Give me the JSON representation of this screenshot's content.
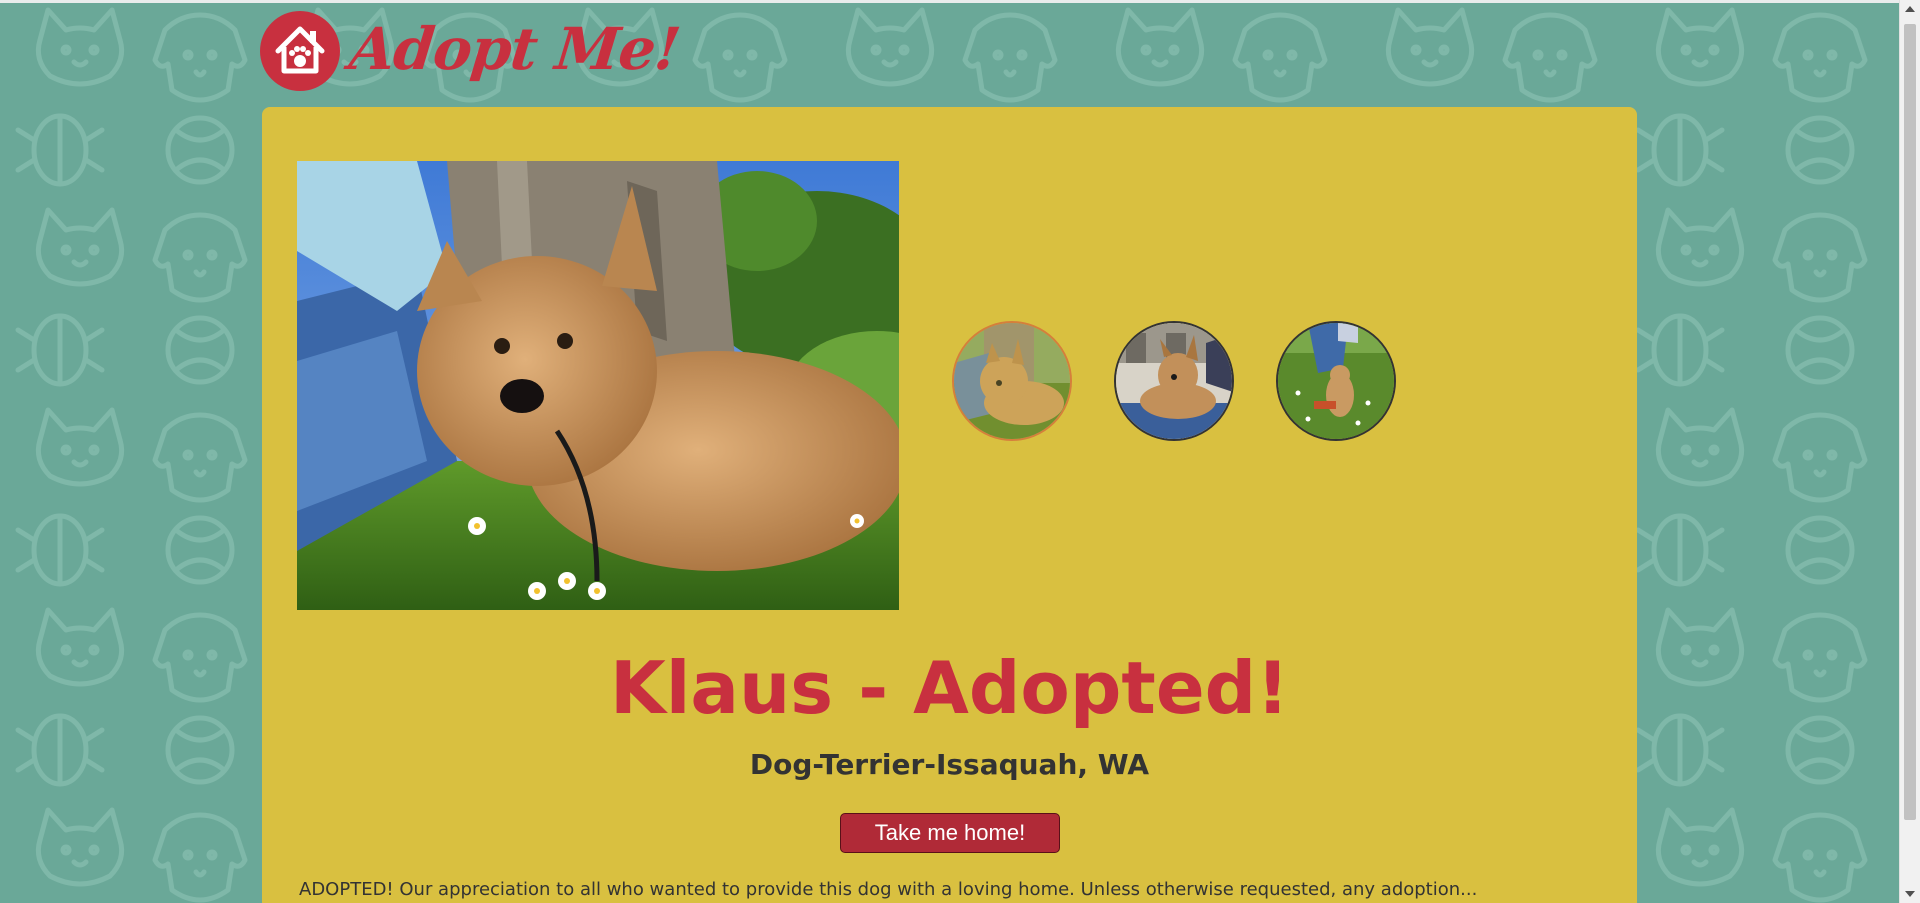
{
  "brand": {
    "logo_text": "Adopt Me!",
    "primary_color": "#c8303f",
    "background_color": "#6aa898",
    "card_color": "#d9c040"
  },
  "pet": {
    "title": "Klaus - Adopted!",
    "subtitle": "Dog-Terrier-Issaquah, WA",
    "description": "ADOPTED! Our appreciation to all who wanted to provide this dog with a loving home. Unless otherwise requested, any adoption..."
  },
  "actions": {
    "adopt_label": "Take me home!"
  },
  "gallery": {
    "active_index": 0
  }
}
